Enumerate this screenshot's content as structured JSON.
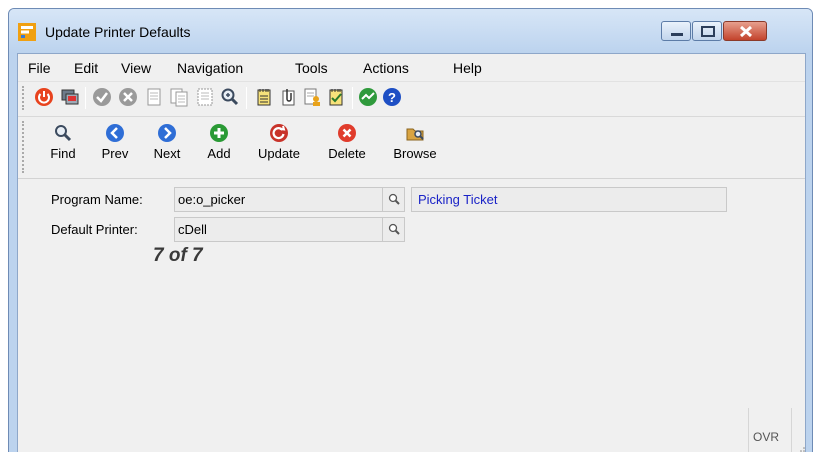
{
  "window": {
    "title": "Update Printer Defaults",
    "controls": [
      "minimize",
      "maximize",
      "close"
    ]
  },
  "menu": [
    "File",
    "Edit",
    "View",
    "Navigation",
    "Tools",
    "Actions",
    "Help"
  ],
  "toolbar_icons": [
    "power-icon",
    "screen-copy-icon",
    "check-icon",
    "cancel-icon",
    "document-icon",
    "document-copy-icon",
    "document-list-icon",
    "zoom-icon",
    "notepad-icon",
    "attachment-icon",
    "document-user-icon",
    "notepad-check-icon",
    "chart-icon",
    "help-icon"
  ],
  "nav_buttons": [
    {
      "label": "Find",
      "icon": "magnifier-icon"
    },
    {
      "label": "Prev",
      "icon": "arrow-left-icon"
    },
    {
      "label": "Next",
      "icon": "arrow-right-icon"
    },
    {
      "label": "Add",
      "icon": "plus-icon"
    },
    {
      "label": "Update",
      "icon": "update-icon"
    },
    {
      "label": "Delete",
      "icon": "delete-icon"
    },
    {
      "label": "Browse",
      "icon": "folder-browse-icon"
    }
  ],
  "form": {
    "program_name_label": "Program Name:",
    "program_name_value": "oe:o_picker",
    "program_description": "Picking Ticket",
    "default_printer_label": "Default Printer:",
    "default_printer_value": "cDell",
    "record_counter": "7 of 7"
  },
  "status": {
    "mode": "OVR"
  },
  "colors": {
    "title_bar": "#bcd3ee",
    "description_text": "#1a23c7",
    "close_button": "#c3432c"
  }
}
